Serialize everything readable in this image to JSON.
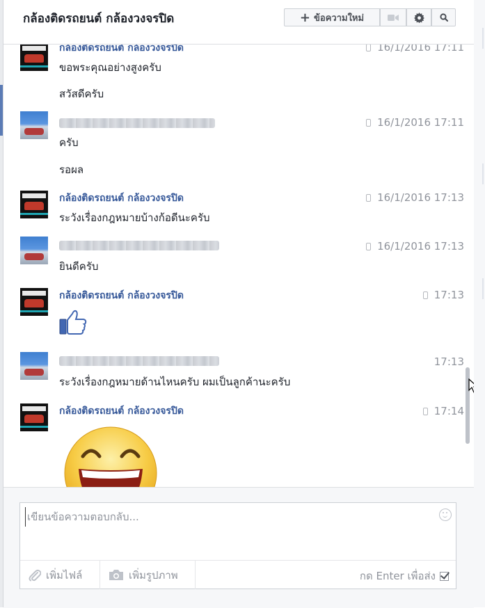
{
  "header": {
    "title": "กล้องติดรถยนต์ กล้องวงจรปิด",
    "new_message_label": "ข้อความใหม่",
    "icons": [
      "plus-icon",
      "video-icon",
      "gear-icon",
      "search-icon"
    ]
  },
  "messages": [
    {
      "sender": "กล้องติดรถยนต์ กล้องวงจรปิด",
      "time": "16/1/2016 17:11",
      "lines": [
        "ขอพระคุณอย่างสูงครับ",
        "สวัสดีครับ"
      ]
    },
    {
      "sender": "",
      "time": "16/1/2016 17:11",
      "lines": [
        "ครับ",
        "รอผล"
      ]
    },
    {
      "sender": "กล้องติดรถยนต์ กล้องวงจรปิด",
      "time": "16/1/2016 17:13",
      "lines": [
        "ระวังเรื่องกฎหมายบ้างก้อดีนะครับ"
      ]
    },
    {
      "sender": "",
      "time": "16/1/2016 17:13",
      "lines": [
        "ยินดีครับ"
      ]
    },
    {
      "sender": "กล้องติดรถยนต์ กล้องวงจรปิด",
      "time": "17:13",
      "sticker": "thumbs-up"
    },
    {
      "sender": "",
      "time": "17:13",
      "lines": [
        "ระวังเรื่องกฎหมายด้านไหนครับ  ผมเป็นลูกค้านะครับ"
      ]
    },
    {
      "sender": "กล้องติดรถยนต์ กล้องวงจรปิด",
      "time": "17:14",
      "sticker": "laughing-face"
    }
  ],
  "composer": {
    "placeholder": "เขียนข้อความตอบกลับ...",
    "attach_label": "เพิ่มไฟล์",
    "photo_label": "เพิ่มรูปภาพ",
    "enter_label": "กด Enter เพื่อส่ง",
    "enter_to_send": true
  },
  "colors": {
    "sender_link": "#365899",
    "timestamp": "#90949c",
    "thumb_blue": "#4267b2",
    "smiley_yellow": "#f7cc46"
  }
}
